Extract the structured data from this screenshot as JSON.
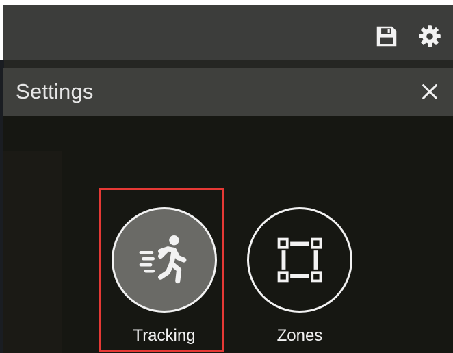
{
  "toolbar": {
    "save_icon": "floppy-disk-icon",
    "gear_icon": "gear-icon"
  },
  "settings": {
    "title": "Settings",
    "close_icon": "close-icon"
  },
  "tiles": [
    {
      "label": "Tracking",
      "icon": "running-person-icon",
      "selected": true
    },
    {
      "label": "Zones",
      "icon": "bounding-box-icon",
      "selected": false
    }
  ],
  "colors": {
    "toolbar_bg": "#3c3d3b",
    "panel_bg": "#161712",
    "selected_tile_fill": "#6a6a66",
    "selection_outline": "#e53935",
    "foreground": "#f2f2f2"
  }
}
